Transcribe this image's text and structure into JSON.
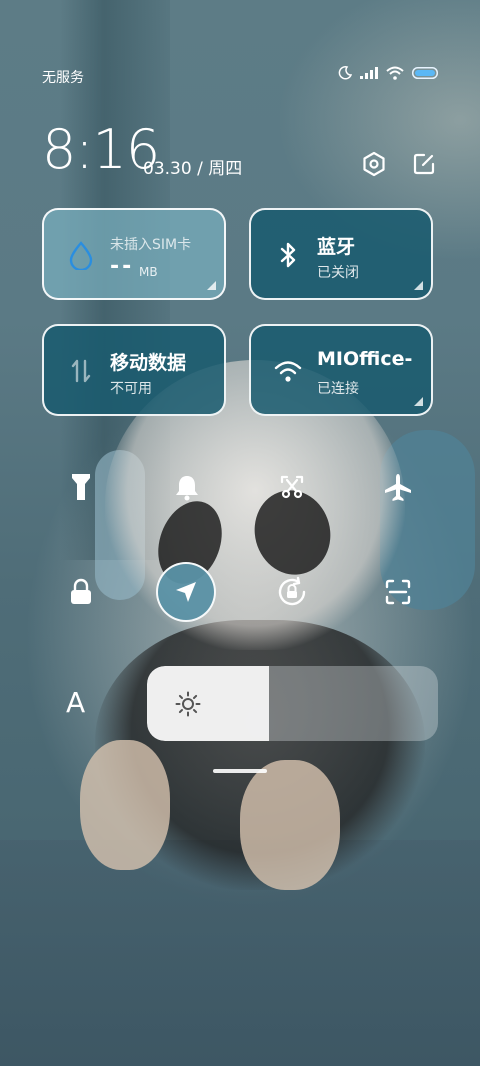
{
  "status_bar": {
    "carrier": "无服务",
    "icons": [
      "moon-icon",
      "signal-icon",
      "wifi-icon",
      "battery-icon"
    ]
  },
  "header": {
    "time": "8:16",
    "date": "03.30 / 周四",
    "actions": [
      "settings-icon",
      "edit-icon"
    ]
  },
  "tiles": {
    "sim": {
      "title": "未插入SIM卡",
      "value": "--",
      "unit": "MB",
      "icon": "water-drop-icon"
    },
    "bluetooth": {
      "title": "蓝牙",
      "subtitle": "已关闭",
      "icon": "bluetooth-icon"
    },
    "mobile_data": {
      "title": "移动数据",
      "subtitle": "不可用",
      "icon": "data-arrows-icon"
    },
    "wifi": {
      "title": "MIOffice-",
      "subtitle": "已连接",
      "icon": "wifi-icon"
    }
  },
  "toggles": [
    {
      "name": "flashlight-icon",
      "active": false
    },
    {
      "name": "bell-icon",
      "active": false
    },
    {
      "name": "screenshot-icon",
      "active": false
    },
    {
      "name": "airplane-icon",
      "active": false
    },
    {
      "name": "lock-icon",
      "active": false
    },
    {
      "name": "location-icon",
      "active": true
    },
    {
      "name": "rotation-lock-icon",
      "active": false
    },
    {
      "name": "scan-icon",
      "active": false
    }
  ],
  "brightness": {
    "label": "A",
    "level": 0.42,
    "icon": "sun-icon"
  },
  "colors": {
    "tile_light": "#78afbe",
    "tile_dark": "#195a6e",
    "accent_blue": "#2a8ee0"
  }
}
